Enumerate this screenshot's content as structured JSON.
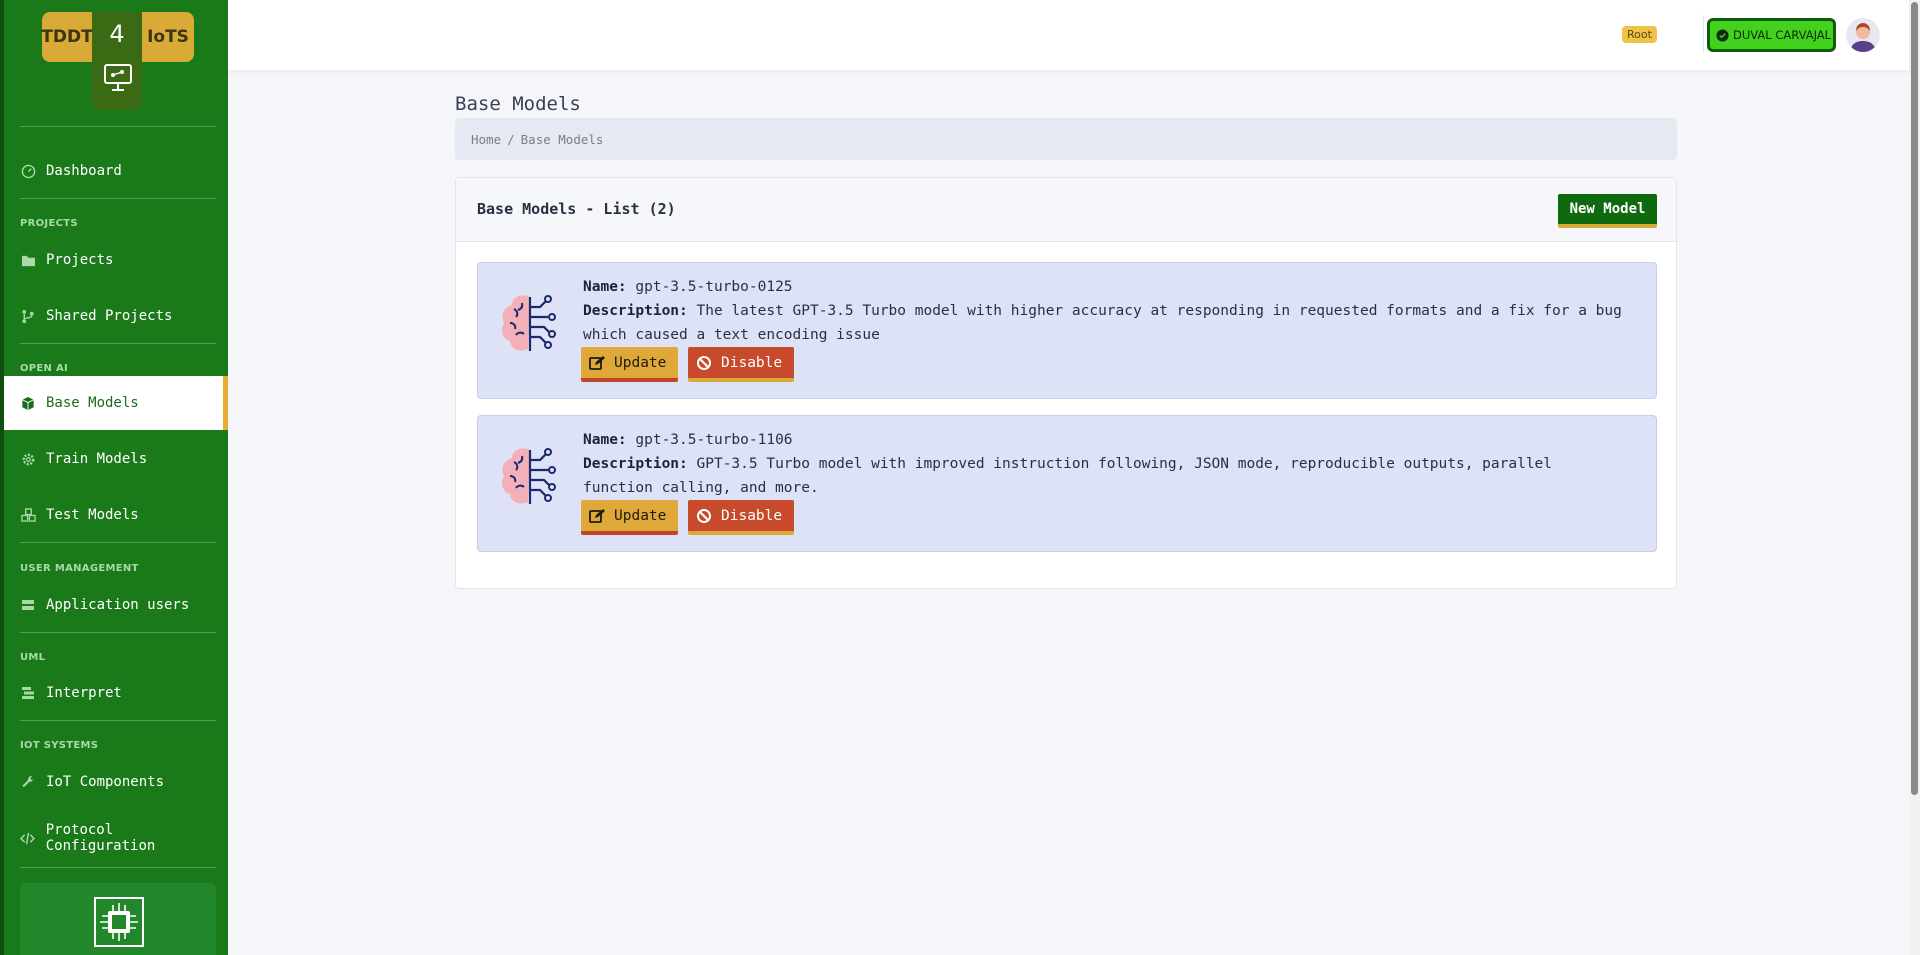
{
  "sidebar": {
    "logo": {
      "left": "TDDT",
      "middle": "4",
      "right": "IoTS"
    },
    "sections": [
      {
        "heading": "",
        "items": [
          {
            "label": "Dashboard",
            "icon": "dashboard-icon"
          }
        ]
      },
      {
        "heading": "PROJECTS",
        "items": [
          {
            "label": "Projects",
            "icon": "folder-icon"
          },
          {
            "label": "Shared Projects",
            "icon": "branch-icon"
          }
        ]
      },
      {
        "heading": "OPEN AI",
        "items": [
          {
            "label": "Base Models",
            "icon": "cube-icon",
            "active": true
          },
          {
            "label": "Train Models",
            "icon": "gear-icon"
          },
          {
            "label": "Test Models",
            "icon": "cubes-icon"
          }
        ]
      },
      {
        "heading": "USER MANAGEMENT",
        "items": [
          {
            "label": "Application users",
            "icon": "users-table-icon"
          }
        ]
      },
      {
        "heading": "UML",
        "items": [
          {
            "label": "Interpret",
            "icon": "layers-icon"
          }
        ]
      },
      {
        "heading": "IOT SYSTEMS",
        "items": [
          {
            "label": "IoT Components",
            "icon": "wrench-icon"
          },
          {
            "label": "Protocol Configuration",
            "icon": "code-icon"
          }
        ]
      }
    ]
  },
  "topbar": {
    "role": "Root",
    "user_name": "DUVAL CARVAJAL"
  },
  "page": {
    "title": "Base Models",
    "breadcrumb": {
      "home": "Home",
      "separator": "/",
      "current": "Base Models"
    }
  },
  "card": {
    "title": "Base Models - List (2)",
    "new_button": "New Model",
    "name_label": "Name:",
    "description_label": "Description:",
    "update_label": "Update",
    "disable_label": "Disable",
    "models": [
      {
        "name": "gpt-3.5-turbo-0125",
        "description": "The latest GPT-3.5 Turbo model with higher accuracy at responding in requested formats and a fix for a bug which caused a text encoding issue"
      },
      {
        "name": "gpt-3.5-turbo-1106",
        "description": "GPT-3.5 Turbo model with improved instruction following, JSON mode, reproducible outputs, parallel function calling, and more."
      }
    ]
  },
  "colors": {
    "sidebar_bg": "#1a7a1a",
    "accent_gold": "#d9aa36",
    "user_button": "#42d11d",
    "disable_red": "#c64a2b",
    "item_bg": "#dde2f6"
  }
}
